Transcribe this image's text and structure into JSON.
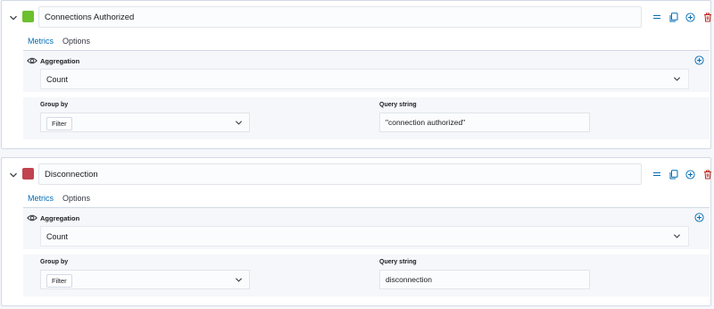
{
  "series": [
    {
      "label": "Connections Authorized",
      "color": "#6cc02e",
      "tabs": [
        "Metrics",
        "Options"
      ],
      "aggregation": {
        "title": "Aggregation",
        "value": "Count"
      },
      "group_by": {
        "title": "Group by",
        "value": "Filter"
      },
      "query": {
        "title": "Query string",
        "value": "\"connection authorized\""
      }
    },
    {
      "label": "Disconnection",
      "color": "#c0434f",
      "tabs": [
        "Metrics",
        "Options"
      ],
      "aggregation": {
        "title": "Aggregation",
        "value": "Count"
      },
      "group_by": {
        "title": "Group by",
        "value": "Filter"
      },
      "query": {
        "title": "Query string",
        "value": "disconnection"
      }
    }
  ],
  "icons": {
    "collapse": "chevron-down-icon",
    "drag": "drag-handle-icon",
    "clone": "copy-icon",
    "add": "plus-circle-icon",
    "delete": "trash-icon",
    "visibility": "eye-icon"
  },
  "colors": {
    "accent": "#006bb4",
    "danger": "#bd271e"
  }
}
